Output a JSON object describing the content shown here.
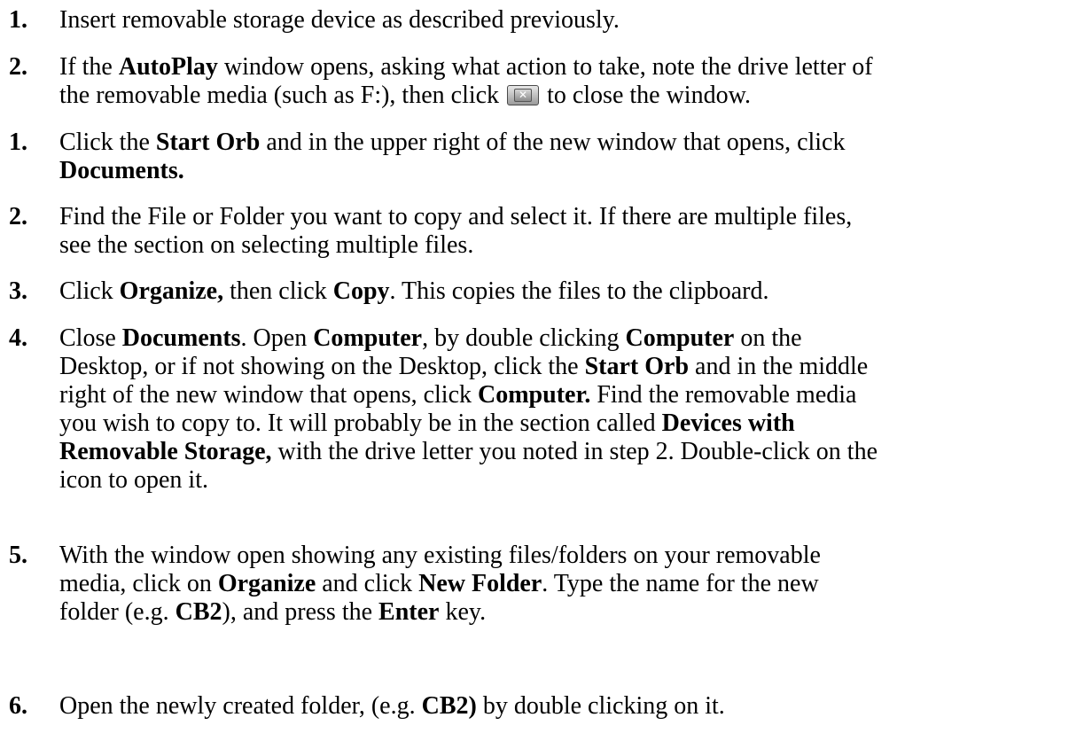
{
  "steps": [
    {
      "number": "1.",
      "parts": [
        "Insert removable storage device as described previously."
      ]
    },
    {
      "number": "2.",
      "parts": [
        "If the ",
        "AutoPlay",
        " window opens, asking what action to take, note the drive letter of",
        "the removable media (such as F:), then click ",
        " to close the window."
      ]
    },
    {
      "number": "1.",
      "parts": [
        "Click the ",
        "Start Orb",
        " and in the upper right of the new window that opens, click",
        "Documents."
      ]
    },
    {
      "number": "2.",
      "parts": [
        "Find the File or Folder you want to copy and select it.  If there are multiple files,",
        "see the section on selecting multiple files."
      ]
    },
    {
      "number": "3.",
      "parts": [
        "Click ",
        "Organize,",
        " then click ",
        "Copy",
        ".  This copies the files to the clipboard."
      ]
    },
    {
      "number": "4.",
      "parts": [
        "Close ",
        "Documents",
        ".  Open ",
        "Computer",
        ", by double clicking ",
        "Computer",
        " on the",
        "Desktop, or if not showing on the Desktop, click the ",
        "Start Orb",
        " and in the middle",
        "right of the new window that opens, click ",
        "Computer.",
        "  Find the removable media",
        "you wish to copy to.  It will probably be in the section called ",
        "Devices with",
        "Removable Storage,",
        " with the drive letter you noted in step 2.  Double-click on the",
        "icon to open it."
      ]
    },
    {
      "number": "5.",
      "parts": [
        "With the window open showing any existing files/folders on your removable",
        "media, click on ",
        "Organize",
        " and click ",
        "New Folder",
        ".  Type the name for the new",
        "folder (e.g. ",
        "CB2",
        "), and press the ",
        "Enter",
        " key."
      ]
    },
    {
      "number": "6.",
      "parts": [
        "Open the newly created folder, (e.g. ",
        "CB2)",
        " by double clicking on it."
      ]
    }
  ],
  "icons": {
    "close_button": "close-x-icon"
  }
}
